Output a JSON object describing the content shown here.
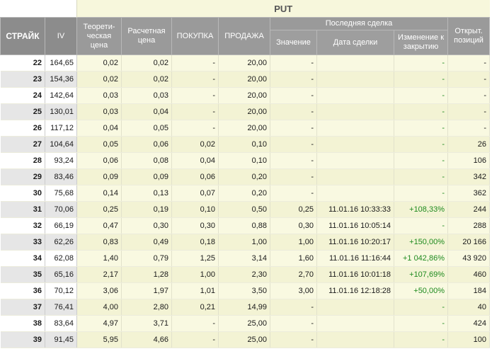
{
  "put_label": "PUT",
  "headers": {
    "strike": "СТРАЙК",
    "iv": "IV",
    "theoretical": "Теорети-ческая цена",
    "settlement": "Расчетная цена",
    "bid": "ПОКУПКА",
    "ask": "ПРОДАЖА",
    "last_trade": "Последняя сделка",
    "value": "Значение",
    "trade_date": "Дата сделки",
    "change": "Изменение к закрытию",
    "open_interest": "Открыт. позиций"
  },
  "rows": [
    {
      "strike": "22",
      "iv": "164,65",
      "theo": "0,02",
      "settle": "0,02",
      "bid": "-",
      "ask": "20,00",
      "value": "-",
      "date": "",
      "change": "-",
      "oi": "-"
    },
    {
      "strike": "23",
      "iv": "154,36",
      "theo": "0,02",
      "settle": "0,02",
      "bid": "-",
      "ask": "20,00",
      "value": "-",
      "date": "",
      "change": "-",
      "oi": "-"
    },
    {
      "strike": "24",
      "iv": "142,64",
      "theo": "0,03",
      "settle": "0,03",
      "bid": "-",
      "ask": "20,00",
      "value": "-",
      "date": "",
      "change": "-",
      "oi": "-"
    },
    {
      "strike": "25",
      "iv": "130,01",
      "theo": "0,03",
      "settle": "0,04",
      "bid": "-",
      "ask": "20,00",
      "value": "-",
      "date": "",
      "change": "-",
      "oi": "-"
    },
    {
      "strike": "26",
      "iv": "117,12",
      "theo": "0,04",
      "settle": "0,05",
      "bid": "-",
      "ask": "20,00",
      "value": "-",
      "date": "",
      "change": "-",
      "oi": "-"
    },
    {
      "strike": "27",
      "iv": "104,64",
      "theo": "0,05",
      "settle": "0,06",
      "bid": "0,02",
      "ask": "0,10",
      "value": "-",
      "date": "",
      "change": "-",
      "oi": "26"
    },
    {
      "strike": "28",
      "iv": "93,24",
      "theo": "0,06",
      "settle": "0,08",
      "bid": "0,04",
      "ask": "0,10",
      "value": "-",
      "date": "",
      "change": "-",
      "oi": "106"
    },
    {
      "strike": "29",
      "iv": "83,46",
      "theo": "0,09",
      "settle": "0,09",
      "bid": "0,06",
      "ask": "0,20",
      "value": "-",
      "date": "",
      "change": "-",
      "oi": "342"
    },
    {
      "strike": "30",
      "iv": "75,68",
      "theo": "0,14",
      "settle": "0,13",
      "bid": "0,07",
      "ask": "0,20",
      "value": "-",
      "date": "",
      "change": "-",
      "oi": "362"
    },
    {
      "strike": "31",
      "iv": "70,06",
      "theo": "0,25",
      "settle": "0,19",
      "bid": "0,10",
      "ask": "0,50",
      "value": "0,25",
      "date": "11.01.16 10:33:33",
      "change": "+108,33%",
      "oi": "244"
    },
    {
      "strike": "32",
      "iv": "66,19",
      "theo": "0,47",
      "settle": "0,30",
      "bid": "0,30",
      "ask": "0,88",
      "value": "0,30",
      "date": "11.01.16 10:05:14",
      "change": "-",
      "oi": "288"
    },
    {
      "strike": "33",
      "iv": "62,26",
      "theo": "0,83",
      "settle": "0,49",
      "bid": "0,18",
      "ask": "1,00",
      "value": "1,00",
      "date": "11.01.16 10:20:17",
      "change": "+150,00%",
      "oi": "20 166"
    },
    {
      "strike": "34",
      "iv": "62,08",
      "theo": "1,40",
      "settle": "0,79",
      "bid": "1,25",
      "ask": "3,14",
      "value": "1,60",
      "date": "11.01.16 11:16:44",
      "change": "+1 042,86%",
      "oi": "43 920"
    },
    {
      "strike": "35",
      "iv": "65,16",
      "theo": "2,17",
      "settle": "1,28",
      "bid": "1,00",
      "ask": "2,30",
      "value": "2,70",
      "date": "11.01.16 10:01:18",
      "change": "+107,69%",
      "oi": "460"
    },
    {
      "strike": "36",
      "iv": "70,12",
      "theo": "3,06",
      "settle": "1,97",
      "bid": "1,01",
      "ask": "3,50",
      "value": "3,00",
      "date": "11.01.16 12:18:28",
      "change": "+50,00%",
      "oi": "184"
    },
    {
      "strike": "37",
      "iv": "76,41",
      "theo": "4,00",
      "settle": "2,80",
      "bid": "0,21",
      "ask": "14,99",
      "value": "-",
      "date": "",
      "change": "-",
      "oi": "40"
    },
    {
      "strike": "38",
      "iv": "83,64",
      "theo": "4,97",
      "settle": "3,71",
      "bid": "-",
      "ask": "25,00",
      "value": "-",
      "date": "",
      "change": "-",
      "oi": "424"
    },
    {
      "strike": "39",
      "iv": "91,45",
      "theo": "5,95",
      "settle": "4,66",
      "bid": "-",
      "ask": "25,00",
      "value": "-",
      "date": "",
      "change": "-",
      "oi": "100"
    }
  ],
  "colors": {
    "header_bg": "#9a9a9a",
    "put_bg": "#f9f9e1",
    "change_positive": "#1e8a1e"
  }
}
